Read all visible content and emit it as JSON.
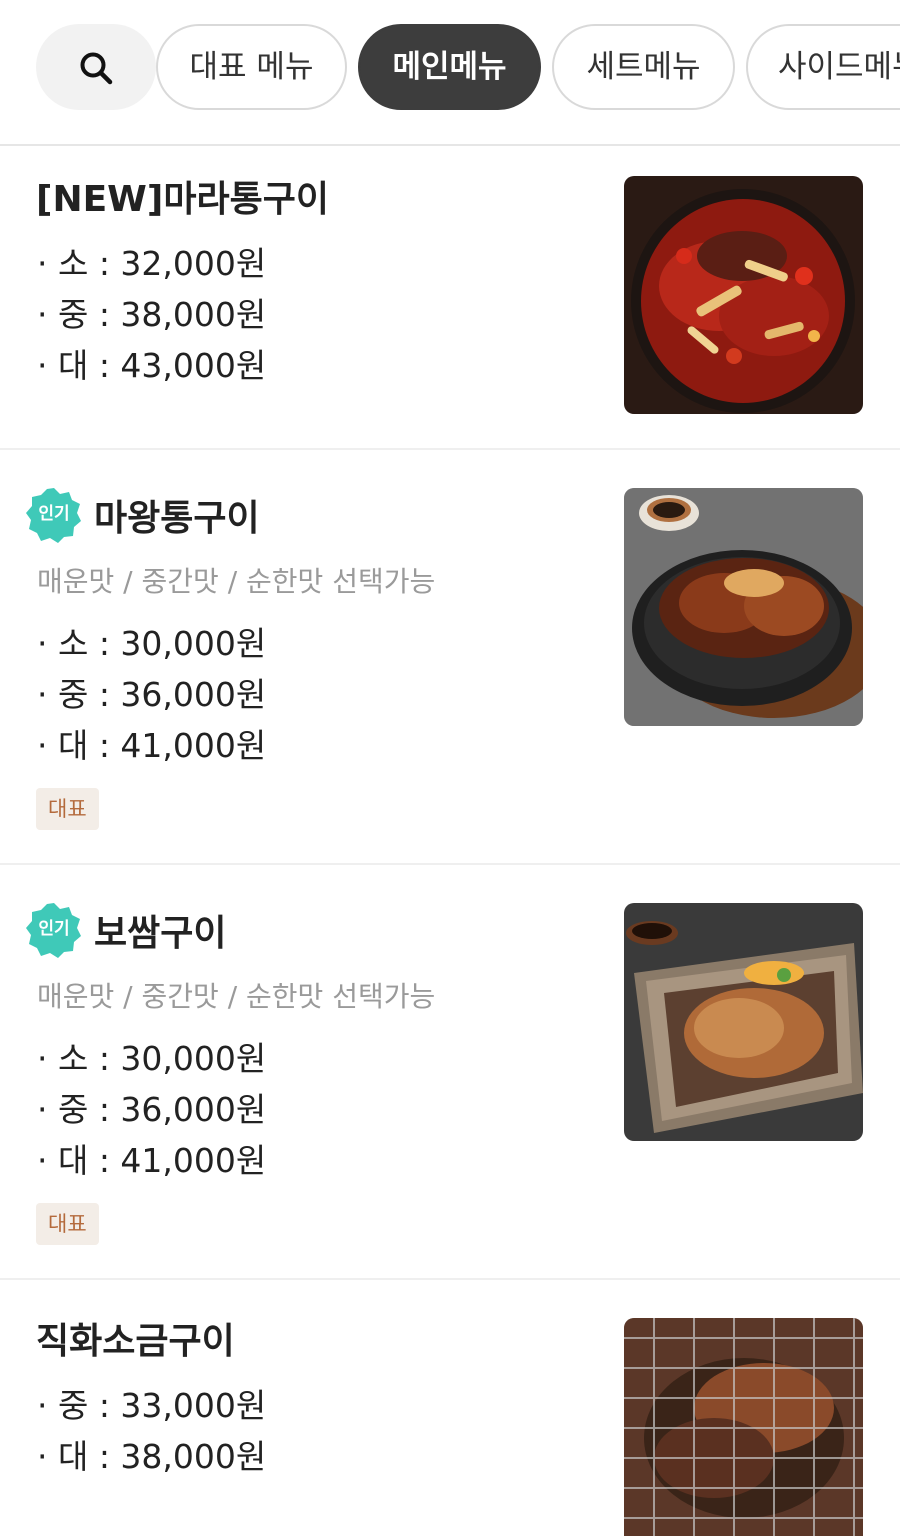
{
  "category_tabs": [
    {
      "label": "대표 메뉴",
      "active": false
    },
    {
      "label": "메인메뉴",
      "active": true
    },
    {
      "label": "세트메뉴",
      "active": false
    },
    {
      "label": "사이드메뉴",
      "active": false
    }
  ],
  "search_icon": "search-icon",
  "menu_items": [
    {
      "title": "[NEW]마라통구이",
      "popular": false,
      "prices": [
        "· 소 : 32,000원",
        "· 중 : 38,000원",
        "· 대 : 43,000원"
      ],
      "image": "mala-grilled-pork-photo"
    },
    {
      "title": "마왕통구이",
      "popular": true,
      "badge_label": "인기",
      "description": "매운맛 / 중간맛 / 순한맛 선택가능",
      "prices": [
        "· 소 : 30,000원",
        "· 중 : 36,000원",
        "· 대 : 41,000원"
      ],
      "tag": "대표",
      "image": "mawang-grilled-pork-photo"
    },
    {
      "title": "보쌈구이",
      "popular": true,
      "badge_label": "인기",
      "description": "매운맛 / 중간맛 / 순한맛 선택가능",
      "prices": [
        "· 소 : 30,000원",
        "· 중 : 36,000원",
        "· 대 : 41,000원"
      ],
      "tag": "대표",
      "image": "bossam-grilled-photo"
    },
    {
      "title": "직화소금구이",
      "popular": false,
      "prices": [
        "· 중 : 33,000원",
        "· 대 : 38,000원"
      ],
      "image": "salt-grilled-pork-photo"
    }
  ],
  "colors": {
    "active_chip": "#3d3d3d",
    "popular_badge": "#3fc9b8",
    "tag_bg": "#f3ede7",
    "tag_text": "#b46a3c"
  }
}
